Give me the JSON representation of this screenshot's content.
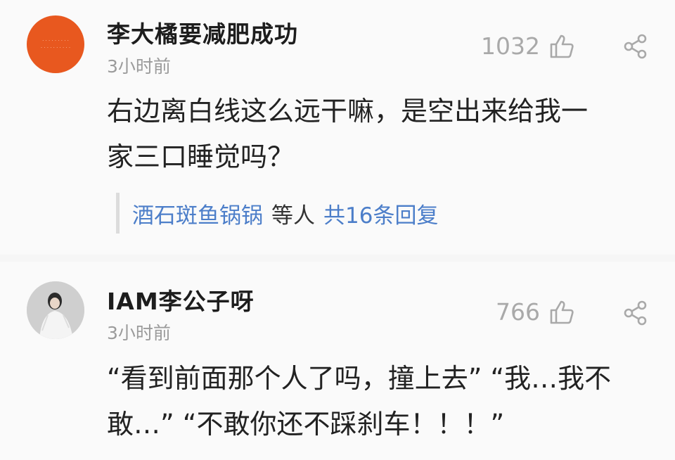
{
  "comments": [
    {
      "username": "李大橘要减肥成功",
      "time": "3小时前",
      "likes": "1032",
      "text_line1": "右边离白线这么远干嘛，是空出来给我一",
      "text_line2": "家三口睡觉吗？",
      "avatar_icon": "orange-avatar",
      "replies": {
        "names": "酒石斑鱼锅锅",
        "middle": "等人",
        "count_text": "共16条回复"
      }
    },
    {
      "username": "IAM李公子呀",
      "time": "3小时前",
      "likes": "766",
      "text_line1": "“看到前面那个人了吗，撞上去” “我…我不",
      "text_line2": "敢…” “不敢你还不踩刹车！！！”",
      "avatar_icon": "photo-avatar"
    }
  ],
  "colors": {
    "link": "#4c7ec9",
    "avatar_orange": "#e8581f",
    "meta_gray": "#9b9b9b"
  },
  "icons": [
    "thumbs-up-icon",
    "share-icon"
  ]
}
